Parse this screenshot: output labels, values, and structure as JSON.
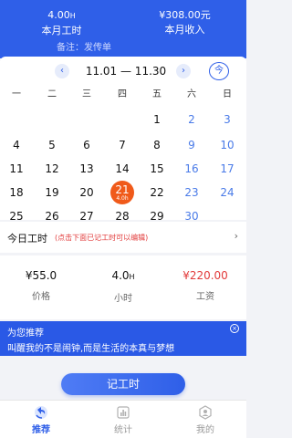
{
  "header": {
    "hours_value": "4.00",
    "hours_unit": "H",
    "hours_label": "本月工时",
    "income_value": "¥308.00元",
    "income_label": "本月收入",
    "note": "备注：发传单"
  },
  "calendar": {
    "month_label": "11.01 — 11.30",
    "prev_icon": "‹",
    "next_icon": "›",
    "today_button": "今",
    "weekdays": [
      "一",
      "二",
      "三",
      "四",
      "五",
      "六",
      "日"
    ],
    "rows": [
      [
        "",
        "",
        "",
        "",
        "1",
        "2",
        "3"
      ],
      [
        "4",
        "5",
        "6",
        "7",
        "8",
        "9",
        "10"
      ],
      [
        "11",
        "12",
        "13",
        "14",
        "15",
        "16",
        "17"
      ],
      [
        "18",
        "19",
        "20",
        "21",
        "22",
        "23",
        "24"
      ],
      [
        "25",
        "26",
        "27",
        "28",
        "29",
        "30",
        ""
      ]
    ],
    "selected_day": "21",
    "selected_hours": "4.0h",
    "weekend_color": "#4a7be8",
    "selected_color": "#f05a1a"
  },
  "today_work": {
    "title": "今日工时",
    "hint": "(点击下面已记工时可以编辑)",
    "chevron": "›"
  },
  "stats": [
    {
      "value": "¥55.0",
      "unit": "",
      "label": "价格"
    },
    {
      "value": "4.0",
      "unit": "H",
      "label": "小时"
    },
    {
      "value": "¥220.00",
      "unit": "",
      "label": "工资"
    }
  ],
  "banner": {
    "title": "为您推荐",
    "text": "叫醒我的不是闹钟,而是生活的本真与梦想",
    "close_icon": "×"
  },
  "record_button": "记工时",
  "tabs": [
    {
      "label": "推荐",
      "icon": "recommend-icon",
      "active": true
    },
    {
      "label": "统计",
      "icon": "stats-icon",
      "active": false
    },
    {
      "label": "我的",
      "icon": "profile-icon",
      "active": false
    }
  ],
  "colors": {
    "primary": "#2f5fe8",
    "accent_red": "#e23b3b"
  }
}
